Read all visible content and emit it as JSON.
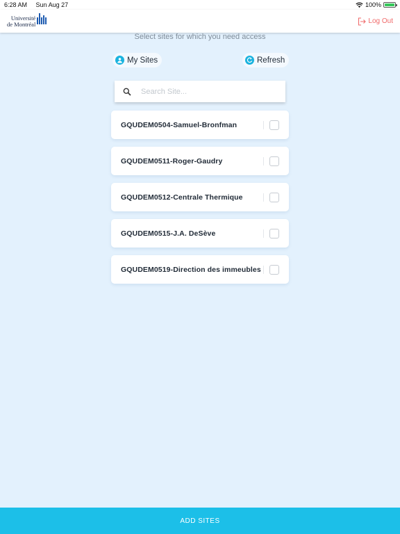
{
  "status_bar": {
    "time": "6:28 AM",
    "date": "Sun Aug 27",
    "battery": "100%",
    "battery_level": 1.0
  },
  "header": {
    "logo_line1": "Université",
    "logo_line2": "de Montréal",
    "logout_label": "Log Out"
  },
  "subtitle": "Select sites for which you need access",
  "toolbar": {
    "my_sites_label": "My Sites",
    "refresh_label": "Refresh"
  },
  "search": {
    "placeholder": "Search Site..."
  },
  "sites": [
    {
      "name": "GQUDEM0504-Samuel-Bronfman",
      "checked": false
    },
    {
      "name": "GQUDEM0511-Roger-Gaudry",
      "checked": false
    },
    {
      "name": "GQUDEM0512-Centrale Thermique",
      "checked": false
    },
    {
      "name": "GQUDEM0515-J.A. DeSève",
      "checked": false
    },
    {
      "name": "GQUDEM0519-Direction des immeubles",
      "checked": false
    }
  ],
  "footer": {
    "add_sites_label": "ADD SITES"
  },
  "colors": {
    "accent": "#1cbfe8",
    "logout": "#f06a6a",
    "background": "#e3f1fd"
  }
}
